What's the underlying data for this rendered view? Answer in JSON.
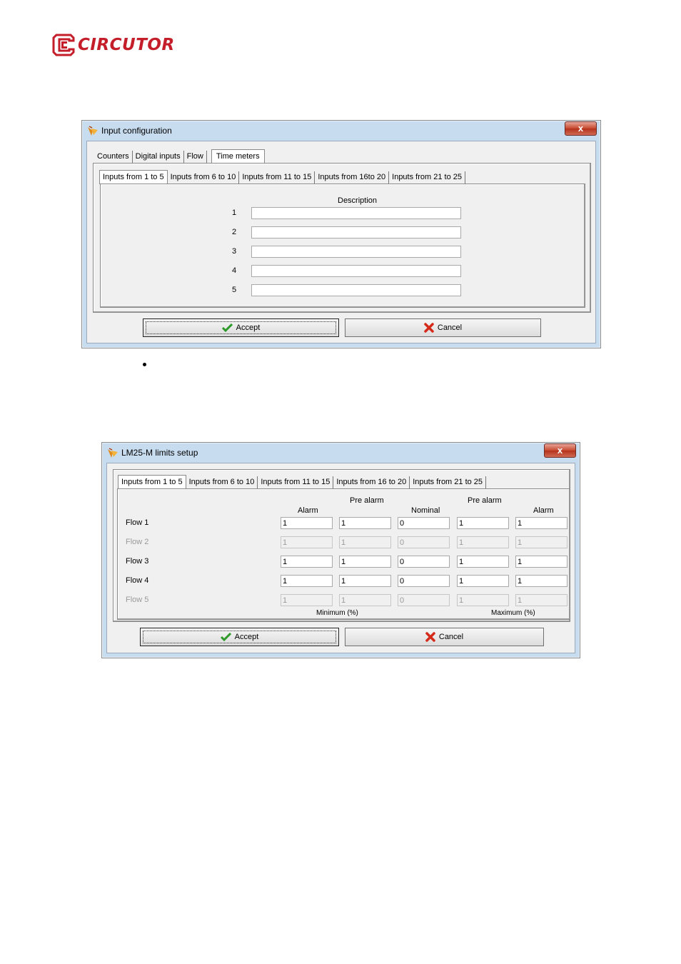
{
  "logo": {
    "text": "CIRCUTOR"
  },
  "window1": {
    "title": "Input configuration",
    "close": "x",
    "tabs": [
      "Counters",
      "Digital inputs",
      "Flow",
      "Time meters"
    ],
    "subtabs": [
      "Inputs from 1 to 5",
      "Inputs from 6 to 10",
      "Inputs from 11 to 15",
      "Inputs from 16to 20",
      "Inputs from 21 to 25"
    ],
    "description_header": "Description",
    "rows": [
      "1",
      "2",
      "3",
      "4",
      "5"
    ],
    "accept": "Accept",
    "cancel": "Cancel"
  },
  "window2": {
    "title": "LM25-M limits setup",
    "close": "x",
    "subtabs": [
      "Inputs from 1 to 5",
      "Inputs from 6 to 10",
      "Inputs from 11 to 15",
      "Inputs from 16 to 20",
      "Inputs from 21 to 25"
    ],
    "headers": {
      "pre_alarm_left": "Pre alarm",
      "pre_alarm_right": "Pre alarm",
      "alarm_left": "Alarm",
      "nominal": "Nominal",
      "alarm_right": "Alarm",
      "minimum": "Minimum (%)",
      "maximum": "Maximum (%)"
    },
    "flows": [
      {
        "label": "Flow 1",
        "values": [
          "1",
          "1",
          "0",
          "1",
          "1"
        ]
      },
      {
        "label": "Flow 2",
        "values": [
          "1",
          "1",
          "0",
          "1",
          "1"
        ]
      },
      {
        "label": "Flow 3",
        "values": [
          "1",
          "1",
          "0",
          "1",
          "1"
        ]
      },
      {
        "label": "Flow 4",
        "values": [
          "1",
          "1",
          "0",
          "1",
          "1"
        ]
      },
      {
        "label": "Flow 5",
        "values": [
          "1",
          "1",
          "0",
          "1",
          "1"
        ]
      }
    ],
    "accept": "Accept",
    "cancel": "Cancel"
  }
}
